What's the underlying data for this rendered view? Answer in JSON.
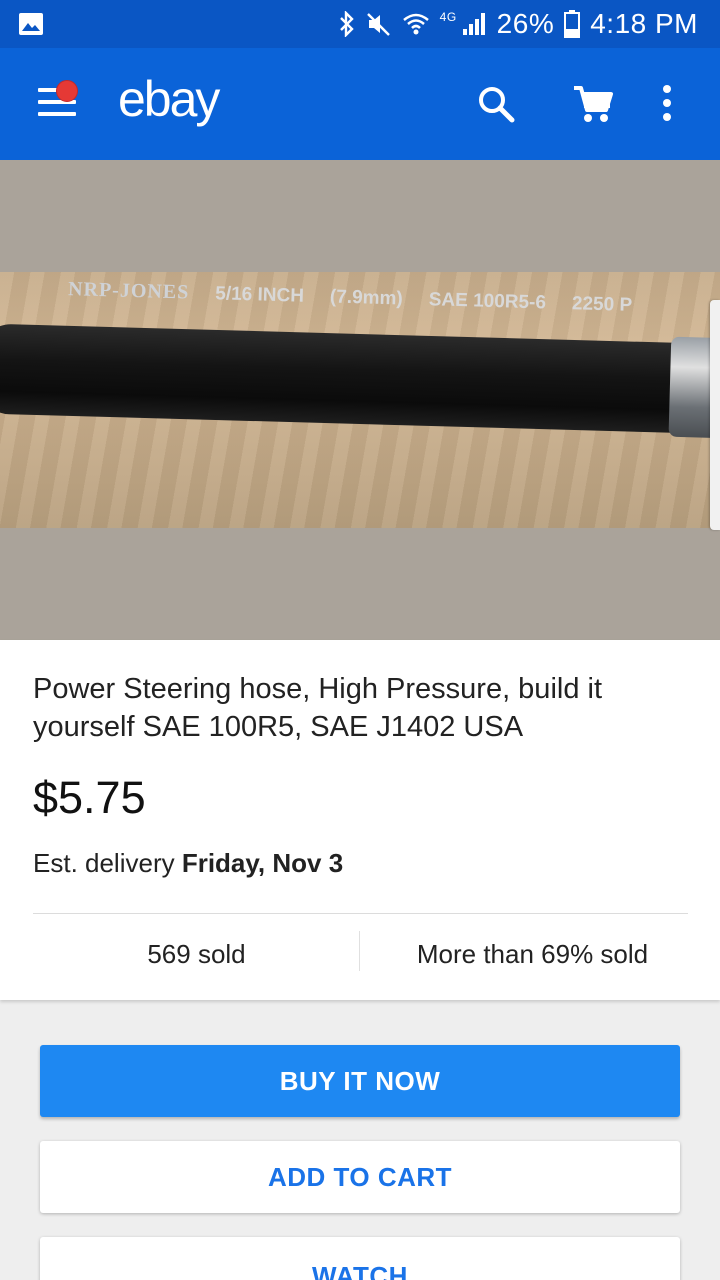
{
  "status_bar": {
    "battery": "26%",
    "time": "4:18 PM",
    "network": "4G"
  },
  "app_bar": {
    "logo": "ebay",
    "icons": [
      "menu-icon",
      "search-icon",
      "cart-icon",
      "more-vert-icon"
    ],
    "notification_color": "#e53935",
    "color": "#0b63d8"
  },
  "product_image": {
    "print": {
      "brand": "NRP-JONES",
      "size": "5/16 INCH",
      "metric": "(7.9mm)",
      "spec": "SAE 100R5-6",
      "rating": "2250 P"
    }
  },
  "listing": {
    "title": "Power Steering hose, High Pressure, build it yourself SAE 100R5,  SAE J1402 USA",
    "price": "$5.75",
    "delivery_prefix": "Est. delivery ",
    "delivery_date": "Friday, Nov 3",
    "sold_count": "569 sold",
    "sold_percent": "More than 69% sold"
  },
  "actions": {
    "buy_now": "BUY IT NOW",
    "add_to_cart": "ADD TO CART",
    "watch": "WATCH",
    "primary_color": "#1e88f2"
  }
}
